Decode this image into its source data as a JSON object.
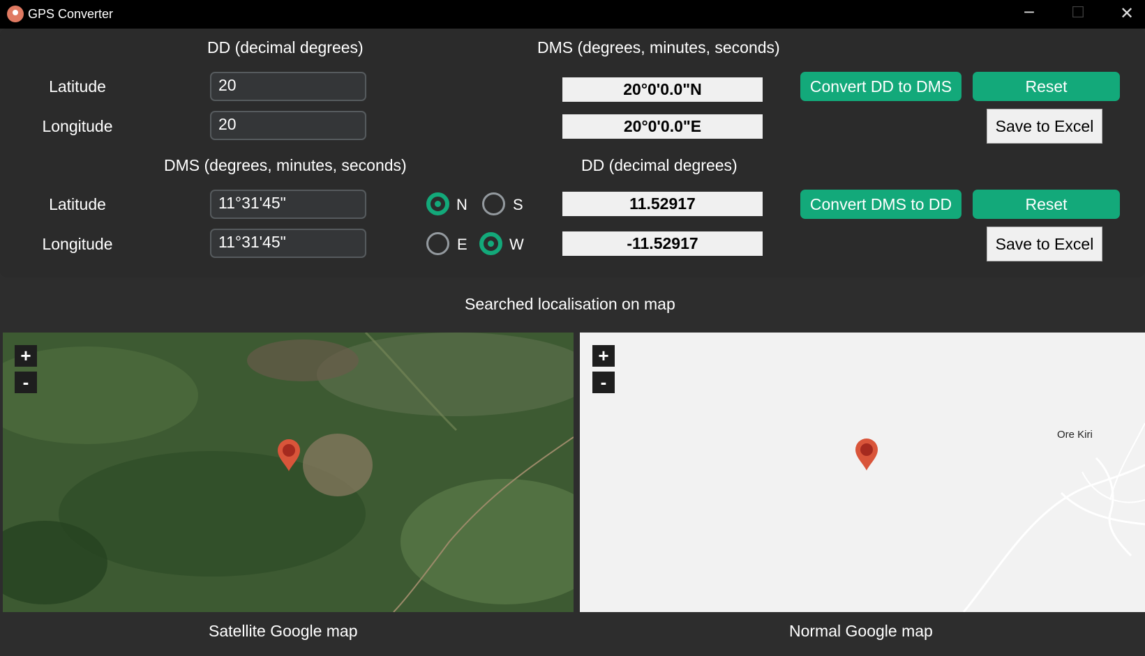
{
  "window": {
    "title": "GPS Converter",
    "minimize": "─",
    "maximize": "☐",
    "close": "✕"
  },
  "dd_to_dms": {
    "header_left": "DD (decimal degrees)",
    "header_right": "DMS (degrees, minutes, seconds)",
    "latitude_label": "Latitude",
    "longitude_label": "Longitude",
    "latitude_value": "20",
    "longitude_value": "20",
    "latitude_result": "20°0'0.0\"N",
    "longitude_result": "20°0'0.0\"E",
    "convert_button": "Convert DD to DMS",
    "reset_button": "Reset",
    "save_button": "Save to Excel"
  },
  "dms_to_dd": {
    "header_left": "DMS (degrees, minutes, seconds)",
    "header_right": "DD (decimal degrees)",
    "latitude_label": "Latitude",
    "longitude_label": "Longitude",
    "latitude_value": "11°31'45\"",
    "longitude_value": "11°31'45\"",
    "lat_options": [
      {
        "label": "N",
        "selected": true
      },
      {
        "label": "S",
        "selected": false
      }
    ],
    "lon_options": [
      {
        "label": "E",
        "selected": false
      },
      {
        "label": "W",
        "selected": true
      }
    ],
    "latitude_result": "11.52917",
    "longitude_result": "-11.52917",
    "convert_button": "Convert DMS to DD",
    "reset_button": "Reset",
    "save_button": "Save to Excel"
  },
  "map_section": {
    "title": "Searched localisation on map",
    "zoom_in": "+",
    "zoom_out": "-",
    "satellite_caption": "Satellite Google map",
    "normal_caption": "Normal Google map",
    "place_label": "Ore Kiri"
  },
  "colors": {
    "accent": "#13a97a",
    "panel": "#2b2b2b",
    "pin": "#d9553a"
  }
}
